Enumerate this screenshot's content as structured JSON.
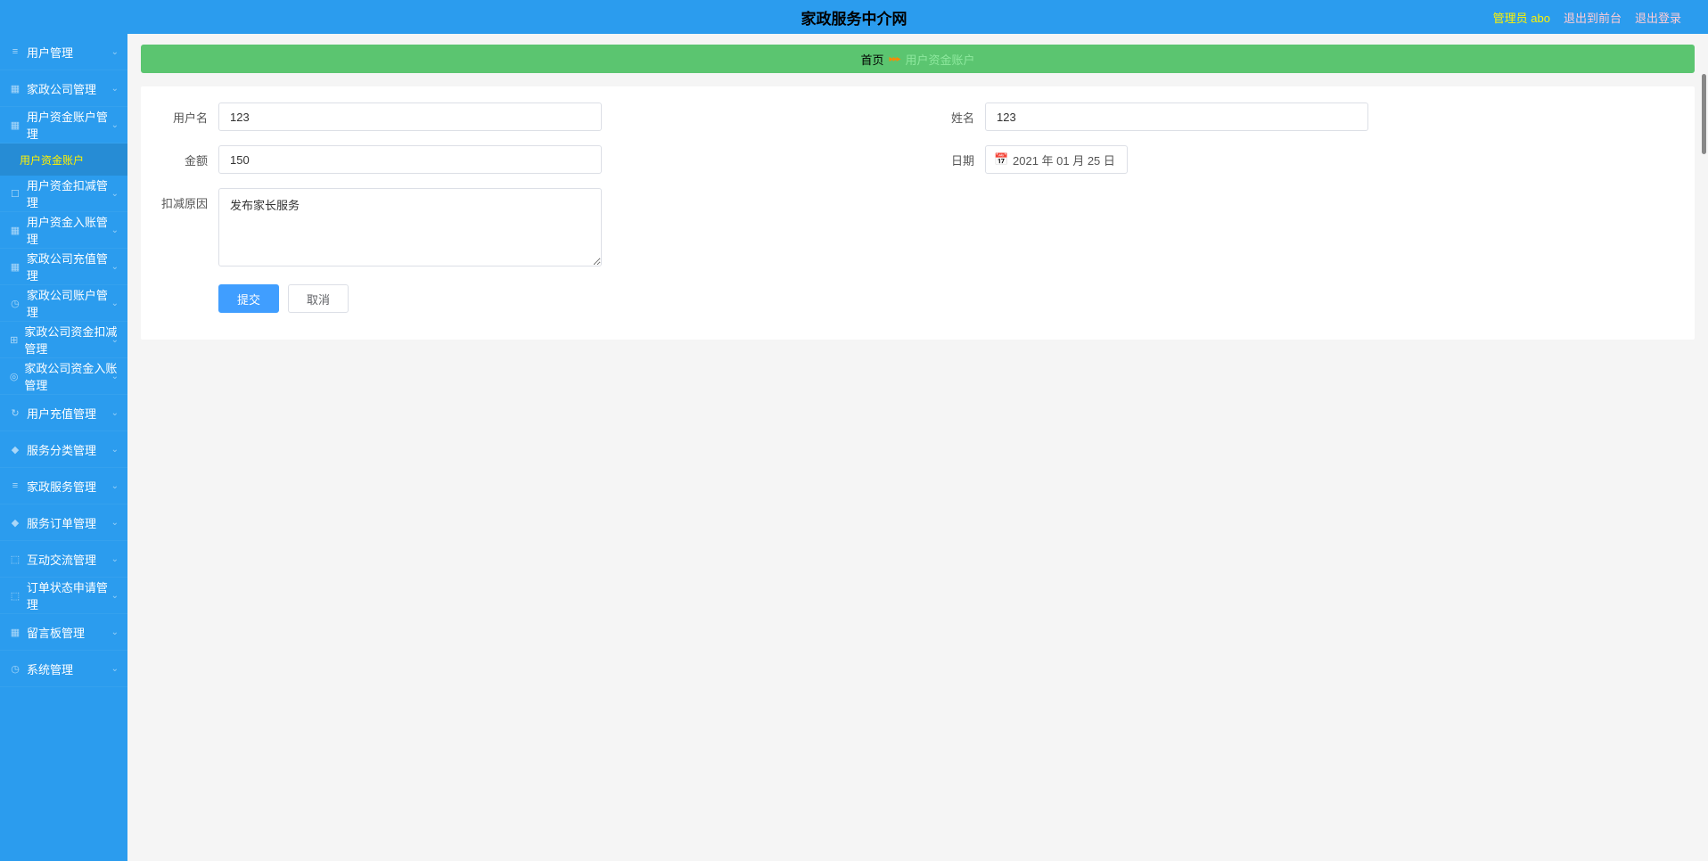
{
  "header": {
    "title": "家政服务中介网",
    "admin_label": "管理员 abo",
    "link_frontend": "退出到前台",
    "link_logout": "退出登录"
  },
  "sidebar": {
    "items": [
      {
        "icon": "≡",
        "label": "用户管理",
        "has_chevron": true
      },
      {
        "icon": "▦",
        "label": "家政公司管理",
        "has_chevron": true
      },
      {
        "icon": "▦",
        "label": "用户资金账户管理",
        "has_chevron": true,
        "expanded": true,
        "children": [
          {
            "label": "用户资金账户"
          }
        ]
      },
      {
        "icon": "☐",
        "label": "用户资金扣减管理",
        "has_chevron": true
      },
      {
        "icon": "▦",
        "label": "用户资金入账管理",
        "has_chevron": true
      },
      {
        "icon": "▦",
        "label": "家政公司充值管理",
        "has_chevron": true
      },
      {
        "icon": "◷",
        "label": "家政公司账户管理",
        "has_chevron": true
      },
      {
        "icon": "⊞",
        "label": "家政公司资金扣减管理",
        "has_chevron": true
      },
      {
        "icon": "◎",
        "label": "家政公司资金入账管理",
        "has_chevron": true
      },
      {
        "icon": "↻",
        "label": "用户充值管理",
        "has_chevron": true
      },
      {
        "icon": "◆",
        "label": "服务分类管理",
        "has_chevron": true
      },
      {
        "icon": "≡",
        "label": "家政服务管理",
        "has_chevron": true
      },
      {
        "icon": "◆",
        "label": "服务订单管理",
        "has_chevron": true
      },
      {
        "icon": "⬚",
        "label": "互动交流管理",
        "has_chevron": true
      },
      {
        "icon": "⬚",
        "label": "订单状态申请管理",
        "has_chevron": true
      },
      {
        "icon": "▦",
        "label": "留言板管理",
        "has_chevron": true
      },
      {
        "icon": "◷",
        "label": "系统管理",
        "has_chevron": true
      }
    ]
  },
  "breadcrumb": {
    "home": "首页",
    "separator": "▸▸▸",
    "current": "用户资金账户"
  },
  "form": {
    "username_label": "用户名",
    "username_value": "123",
    "name_label": "姓名",
    "name_value": "123",
    "amount_label": "金额",
    "amount_value": "150",
    "date_label": "日期",
    "date_value": "2021 年 01 月 25 日",
    "reason_label": "扣减原因",
    "reason_value": "发布家长服务",
    "submit_label": "提交",
    "cancel_label": "取消"
  }
}
